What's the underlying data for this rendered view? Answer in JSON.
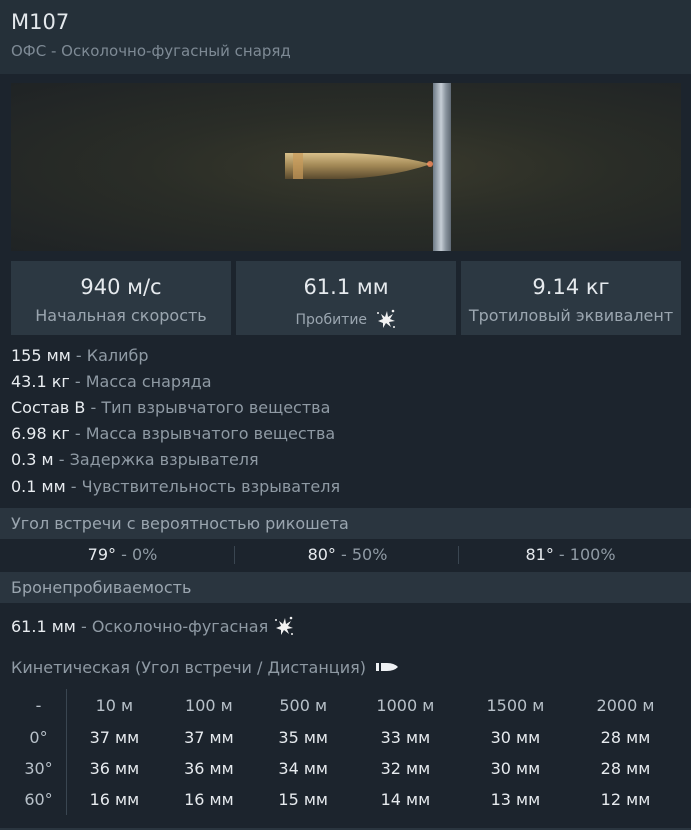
{
  "header": {
    "title": "M107",
    "subtitle": "ОФС - Осколочно-фугасный снаряд"
  },
  "stats": [
    {
      "value": "940 м/с",
      "label": "Начальная скорость"
    },
    {
      "value": "61.1 мм",
      "label": "Пробитие"
    },
    {
      "value": "9.14 кг",
      "label": "Тротиловый эквивалент"
    }
  ],
  "properties": [
    {
      "value": "155 мм",
      "label": "- Калибр"
    },
    {
      "value": "43.1 кг",
      "label": "- Масса снаряда"
    },
    {
      "value": "Состав B",
      "label": "- Тип взрывчатого вещества"
    },
    {
      "value": "6.98 кг",
      "label": "- Масса взрывчатого вещества"
    },
    {
      "value": "0.3 м",
      "label": "- Задержка взрывателя"
    },
    {
      "value": "0.1 мм",
      "label": "- Чувствительность взрывателя"
    }
  ],
  "ricochet": {
    "title": "Угол встречи с вероятностью рикошета",
    "items": [
      {
        "angle": "79°",
        "prob": "- 0%"
      },
      {
        "angle": "80°",
        "prob": "- 50%"
      },
      {
        "angle": "81°",
        "prob": "- 100%"
      }
    ]
  },
  "penetration": {
    "title": "Бронепробиваемость",
    "he_value": "61.1 мм",
    "he_label": "- Осколочно-фугасная",
    "kinetic_title": "Кинетическая (Угол встречи / Дистанция)",
    "header": [
      "-",
      "10 м",
      "100 м",
      "500 м",
      "1000 м",
      "1500 м",
      "2000 м"
    ],
    "rows": [
      [
        "0°",
        "37 мм",
        "37 мм",
        "35 мм",
        "33 мм",
        "30 мм",
        "28 мм"
      ],
      [
        "30°",
        "36 мм",
        "36 мм",
        "34 мм",
        "32 мм",
        "30 мм",
        "28 мм"
      ],
      [
        "60°",
        "16 мм",
        "16 мм",
        "15 мм",
        "14 мм",
        "13 мм",
        "12 мм"
      ]
    ]
  },
  "icons": {
    "explosion": "explosion-icon",
    "shell": "shell-icon"
  }
}
